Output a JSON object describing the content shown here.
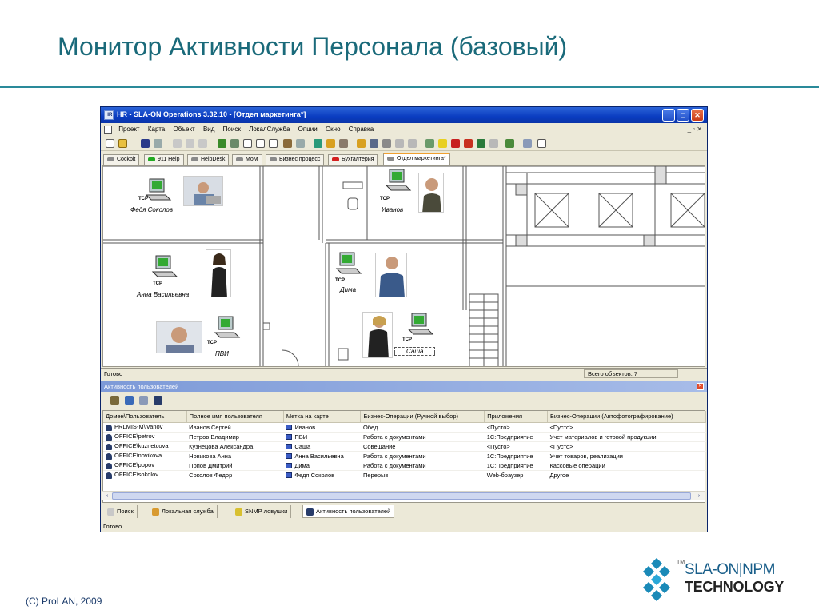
{
  "slide": {
    "title": "Монитор Активности Персонала (базовый)",
    "footer": "(C) ProLAN, 2009",
    "logo": {
      "tm": "TM",
      "line1": "SLA-ON|NPM",
      "line2": "TECHNOLOGY"
    },
    "colors": {
      "title": "#1a6a7a",
      "rule": "#2a8a9a"
    }
  },
  "window": {
    "title": "HR - SLA-ON Operations 3.32.10 - [Отдел маркетинга*]",
    "app_icon": "hr-app-icon",
    "controls": {
      "minimize": "_",
      "maximize": "□",
      "close": "✕"
    },
    "menu": [
      "Проект",
      "Карта",
      "Объект",
      "Вид",
      "Поиск",
      "ЛокалСлужба",
      "Опции",
      "Окно",
      "Справка"
    ],
    "mdi_controls": "_ ▫ ✕",
    "tabs": [
      {
        "label": "Cockpit",
        "led": "#8a8a8a"
      },
      {
        "label": "911 Help",
        "led": "#22aa22"
      },
      {
        "label": "HelpDesk",
        "led": "#8a8a8a"
      },
      {
        "label": "MoM",
        "led": "#8a8a8a"
      },
      {
        "label": "Бизнес процесс",
        "led": "#8a8a8a"
      },
      {
        "label": "Бухгалтерия",
        "led": "#d42020"
      },
      {
        "label": "Отдел маркетинга*",
        "led": "#8a8a8a"
      }
    ],
    "map": {
      "tcp_label": "TCP",
      "people": [
        {
          "name": "Федя Соколов"
        },
        {
          "name": "Иванов"
        },
        {
          "name": "Анна Васильевна"
        },
        {
          "name": "Дима"
        },
        {
          "name": "ПВИ"
        },
        {
          "name": "Саша"
        }
      ]
    },
    "status_ready": "Готово",
    "status_count": "Всего объектов: 7",
    "panel": {
      "title": "Активность пользователей",
      "columns": [
        "Домен\\Пользователь",
        "Полное имя пользователя",
        "Метка на карте",
        "Бизнес-Операции (Ручной выбор)",
        "Приложения",
        "Бизнес-Операции (Автофотографирование)"
      ],
      "rows": [
        [
          "PRLMIS-M\\ivanov",
          "Иванов Сергей",
          "Иванов",
          "Обед",
          "<Пусто>",
          "<Пусто>"
        ],
        [
          "OFFICE\\petrov",
          "Петров Владимир",
          "ПВИ",
          "Работа с документами",
          "1С:Предприятие",
          "Учет материалов и готовой продукции"
        ],
        [
          "OFFICE\\kuznetcova",
          "Кузнецова Александра",
          "Саша",
          "Совещание",
          "<Пусто>",
          "<Пусто>"
        ],
        [
          "OFFICE\\novikova",
          "Новикова Анна",
          "Анна Васильевна",
          "Работа с документами",
          "1С:Предприятие",
          "Учет товаров, реализации"
        ],
        [
          "OFFICE\\popov",
          "Попов Дмитрий",
          "Дима",
          "Работа с документами",
          "1С:Предприятие",
          "Кассовые операции"
        ],
        [
          "OFFICE\\sokolov",
          "Соколов Федор",
          "Федя Соколов",
          "Перерыв",
          "Web-браузер",
          "Другое"
        ]
      ]
    },
    "bottom_tabs": [
      {
        "label": "Поиск",
        "icon": "search-icon"
      },
      {
        "label": "Локальная служба",
        "icon": "local-service-icon"
      },
      {
        "label": "SNMP ловушки",
        "icon": "bell-icon"
      },
      {
        "label": "Активность пользователей",
        "icon": "users-icon"
      }
    ],
    "status_bottom": "Готово"
  }
}
